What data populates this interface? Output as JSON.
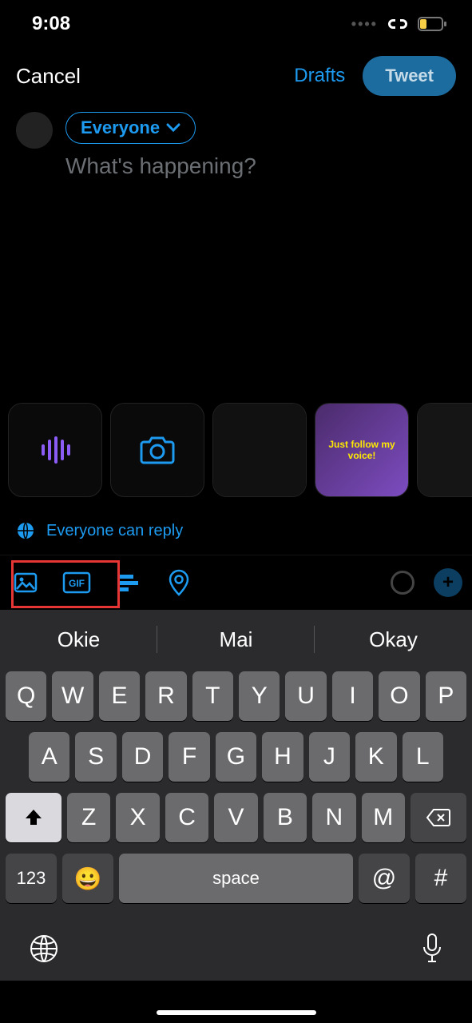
{
  "status": {
    "time": "9:08"
  },
  "header": {
    "cancel": "Cancel",
    "drafts": "Drafts",
    "tweet": "Tweet"
  },
  "compose": {
    "audience": "Everyone",
    "placeholder": "What's happening?"
  },
  "media": {
    "thumb3_caption": "Just follow my voice!"
  },
  "reply": {
    "label": "Everyone can reply"
  },
  "toolbar": {
    "gif": "GIF"
  },
  "suggestions": [
    "Okie",
    "Mai",
    "Okay"
  ],
  "keys": {
    "row1": [
      "Q",
      "W",
      "E",
      "R",
      "T",
      "Y",
      "U",
      "I",
      "O",
      "P"
    ],
    "row2": [
      "A",
      "S",
      "D",
      "F",
      "G",
      "H",
      "J",
      "K",
      "L"
    ],
    "row3": [
      "Z",
      "X",
      "C",
      "V",
      "B",
      "N",
      "M"
    ],
    "num": "123",
    "space": "space",
    "at": "@",
    "hash": "#"
  }
}
